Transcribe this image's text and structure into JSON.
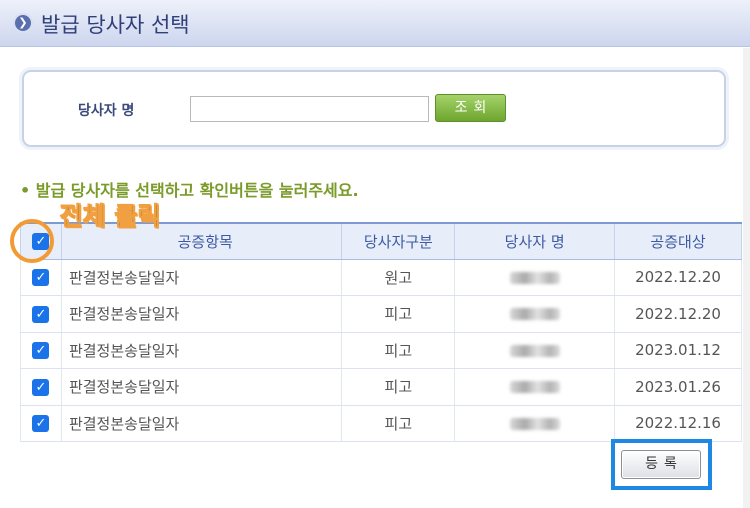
{
  "header": {
    "title": "발급 당사자 선택",
    "icon": "chevron-right-circle-icon"
  },
  "search": {
    "label": "당사자 명",
    "value": "",
    "placeholder": "",
    "button_label": "조회"
  },
  "instruction": "• 발급 당사자를 선택하고 확인버튼을 눌러주세요.",
  "annotation": {
    "select_all_note": "전체 클릭",
    "highlight_color": "#f29a34",
    "register_frame_color": "#1e88e5"
  },
  "table": {
    "select_all_checked": true,
    "columns": [
      "공증항목",
      "당사자구분",
      "당사자 명",
      "공증대상"
    ],
    "rows": [
      {
        "checked": true,
        "item": "판결정본송달일자",
        "type": "원고",
        "target": "2022.12.20"
      },
      {
        "checked": true,
        "item": "판결정본송달일자",
        "type": "피고",
        "target": "2022.12.20"
      },
      {
        "checked": true,
        "item": "판결정본송달일자",
        "type": "피고",
        "target": "2023.01.12"
      },
      {
        "checked": true,
        "item": "판결정본송달일자",
        "type": "피고",
        "target": "2023.01.26"
      },
      {
        "checked": true,
        "item": "판결정본송달일자",
        "type": "피고",
        "target": "2022.12.16"
      }
    ]
  },
  "actions": {
    "register_label": "등록"
  },
  "colors": {
    "accent": "#3d5aa3",
    "instruction": "#7a9b2a",
    "search_button": "#6ea52e",
    "checkbox": "#1a73e8"
  }
}
